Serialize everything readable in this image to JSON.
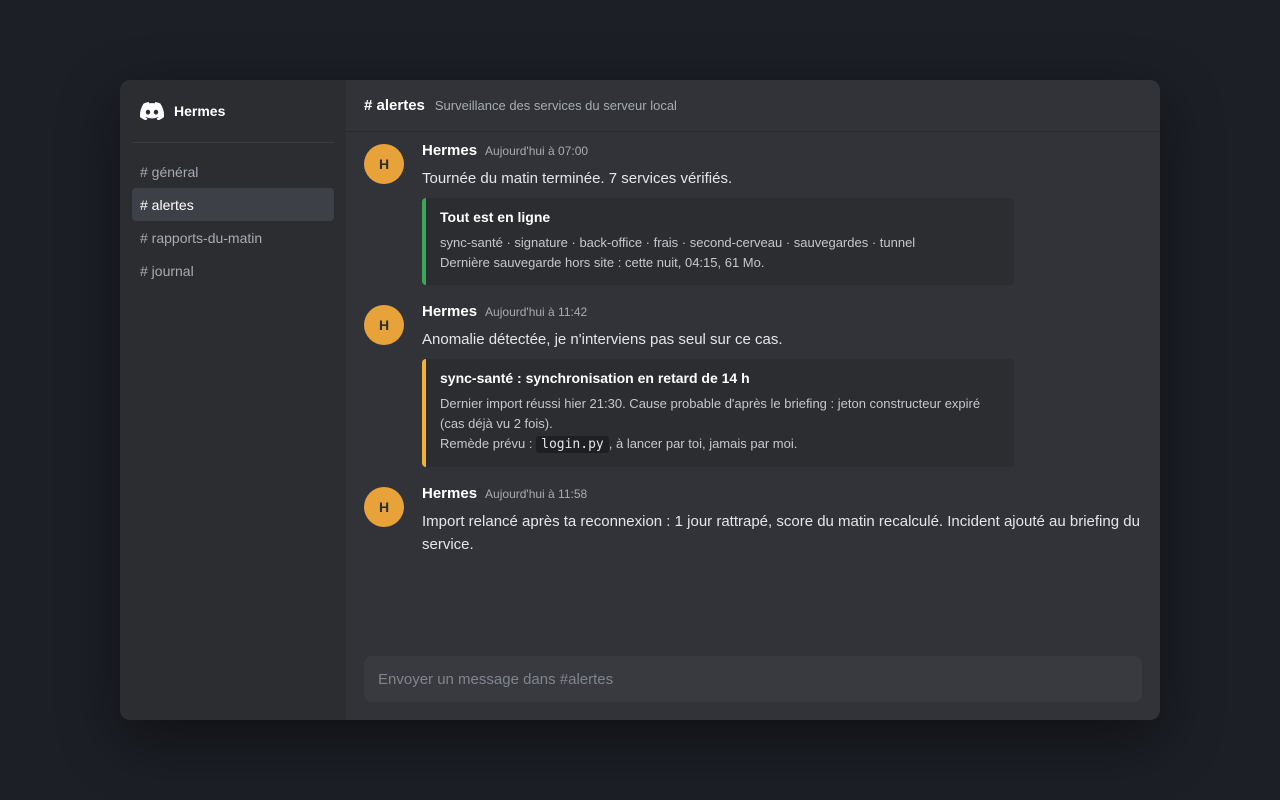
{
  "server": {
    "name": "Hermes",
    "logo_icon": "discord-logo-icon"
  },
  "channels": [
    {
      "label": "# général",
      "active": false
    },
    {
      "label": "# alertes",
      "active": true
    },
    {
      "label": "# rapports-du-matin",
      "active": false
    },
    {
      "label": "# journal",
      "active": false
    }
  ],
  "header": {
    "channel": "# alertes",
    "topic": "Surveillance des services du serveur local"
  },
  "messages": [
    {
      "avatar": "H",
      "author": "Hermes",
      "time": "Aujourd'hui à 07:00",
      "text": "Tournée du matin terminée. 7 services vérifiés.",
      "embed": {
        "status": "ok",
        "title": "Tout est en ligne",
        "line1": "sync-santé · signature · back-office · frais · second-cerveau · sauvegardes · tunnel",
        "line2": "Dernière sauvegarde hors site : cette nuit, 04:15, 61 Mo."
      }
    },
    {
      "avatar": "H",
      "author": "Hermes",
      "time": "Aujourd'hui à 11:42",
      "text": "Anomalie détectée, je n'interviens pas seul sur ce cas.",
      "embed": {
        "status": "warning",
        "title": "sync-santé : synchronisation en retard de 14 h",
        "line1": "Dernier import réussi hier 21:30. Cause probable d'après le briefing : jeton constructeur expiré (cas déjà vu 2 fois).",
        "line2_prefix": "Remède prévu :",
        "line2_code": "login.py",
        "line2_suffix": ", à lancer par toi, jamais par moi."
      }
    },
    {
      "avatar": "H",
      "author": "Hermes",
      "time": "Aujourd'hui à 11:58",
      "text": "Import relancé après ta reconnexion : 1 jour rattrapé, score du matin recalculé. Incident ajouté au briefing du service."
    }
  ],
  "composer": {
    "placeholder": "Envoyer un message dans #alertes"
  },
  "colors": {
    "accent_ok": "#3ba55d",
    "accent_warning": "#f0b232",
    "avatar": "#e8a23a"
  }
}
